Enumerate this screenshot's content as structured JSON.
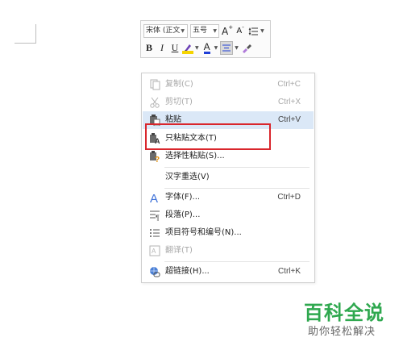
{
  "toolbar": {
    "font_family": "宋体 (正文",
    "font_size": "五号",
    "grow_font_label": "A",
    "shrink_font_label": "A",
    "bold_label": "B",
    "italic_label": "I",
    "underline_label": "U",
    "font_color_label": "A",
    "highlight_color": "#f5d400",
    "font_color": "#1f3fd6"
  },
  "menu": {
    "items": [
      {
        "label": "复制(C)",
        "shortcut": "Ctrl+C",
        "icon": "copy-icon",
        "enabled": false
      },
      {
        "label": "剪切(T)",
        "shortcut": "Ctrl+X",
        "icon": "scissors-icon",
        "enabled": false
      },
      {
        "label": "粘贴",
        "shortcut": "Ctrl+V",
        "icon": "paste-icon",
        "enabled": true
      },
      {
        "label": "只粘贴文本(T)",
        "shortcut": "",
        "icon": "paste-text-only-icon",
        "enabled": true
      },
      {
        "label": "选择性粘贴(S)...",
        "shortcut": "",
        "icon": "paste-special-icon",
        "enabled": true
      },
      {
        "label": "汉字重选(V)",
        "shortcut": "",
        "icon": "",
        "enabled": true
      },
      {
        "label": "字体(F)...",
        "shortcut": "Ctrl+D",
        "icon": "font-icon",
        "enabled": true
      },
      {
        "label": "段落(P)...",
        "shortcut": "",
        "icon": "paragraph-icon",
        "enabled": true
      },
      {
        "label": "项目符号和编号(N)...",
        "shortcut": "",
        "icon": "bullet-list-icon",
        "enabled": true
      },
      {
        "label": "翻译(T)",
        "shortcut": "",
        "icon": "translate-icon",
        "enabled": false
      },
      {
        "label": "超链接(H)...",
        "shortcut": "Ctrl+K",
        "icon": "hyperlink-icon",
        "enabled": true
      }
    ]
  },
  "watermark": {
    "title": "百科全说",
    "subtitle": "助你轻松解决"
  },
  "colors": {
    "highlight_box": "#d9262c",
    "hover": "#dbe8f7",
    "watermark": "#2fa84f"
  }
}
